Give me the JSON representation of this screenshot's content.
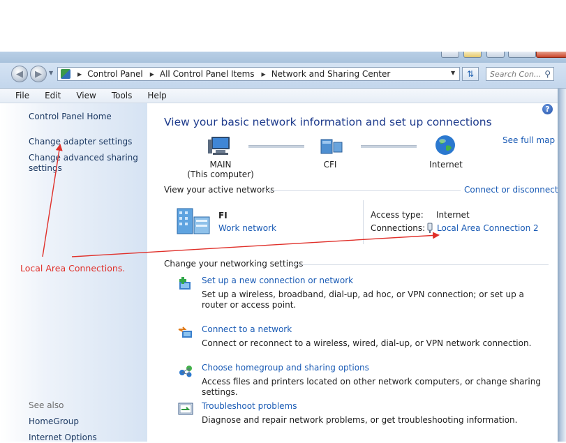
{
  "address_bar": {
    "crumbs": [
      "Control Panel",
      "All Control Panel Items",
      "Network and Sharing Center"
    ],
    "search_placeholder": "Search Con..."
  },
  "menu": [
    "File",
    "Edit",
    "View",
    "Tools",
    "Help"
  ],
  "sidebar": {
    "links": [
      "Control Panel Home",
      "Change adapter settings",
      "Change advanced sharing",
      "settings"
    ],
    "see_also_label": "See also",
    "see_also": [
      "HomeGroup",
      "Internet Options"
    ]
  },
  "main": {
    "title": "View your basic network information and set up connections",
    "see_full_map": "See full map",
    "network_map": {
      "computer_name": "MAIN",
      "computer_sub": "(This computer)",
      "middle": "CFI",
      "internet": "Internet"
    },
    "active_networks_heading": "View your active networks",
    "connect_or_disconnect": "Connect or disconnect",
    "active_network": {
      "name": "FI",
      "type": "Work network",
      "access_type_label": "Access type:",
      "access_type_value": "Internet",
      "connections_label": "Connections:",
      "connection_name": "Local Area Connection 2"
    },
    "settings_heading": "Change your networking settings",
    "tasks": [
      {
        "title": "Set up a new connection or network",
        "desc": "Set up a wireless, broadband, dial-up, ad hoc, or VPN connection; or set up a router or access point."
      },
      {
        "title": "Connect to a network",
        "desc": "Connect or reconnect to a wireless, wired, dial-up, or VPN network connection."
      },
      {
        "title": "Choose homegroup and sharing options",
        "desc": "Access files and printers located on other network computers, or change sharing settings."
      },
      {
        "title": "Troubleshoot problems",
        "desc": "Diagnose and repair network problems, or get troubleshooting information."
      }
    ]
  },
  "annotation": {
    "text": "Local Area Connections.",
    "color": "#e0302a"
  }
}
